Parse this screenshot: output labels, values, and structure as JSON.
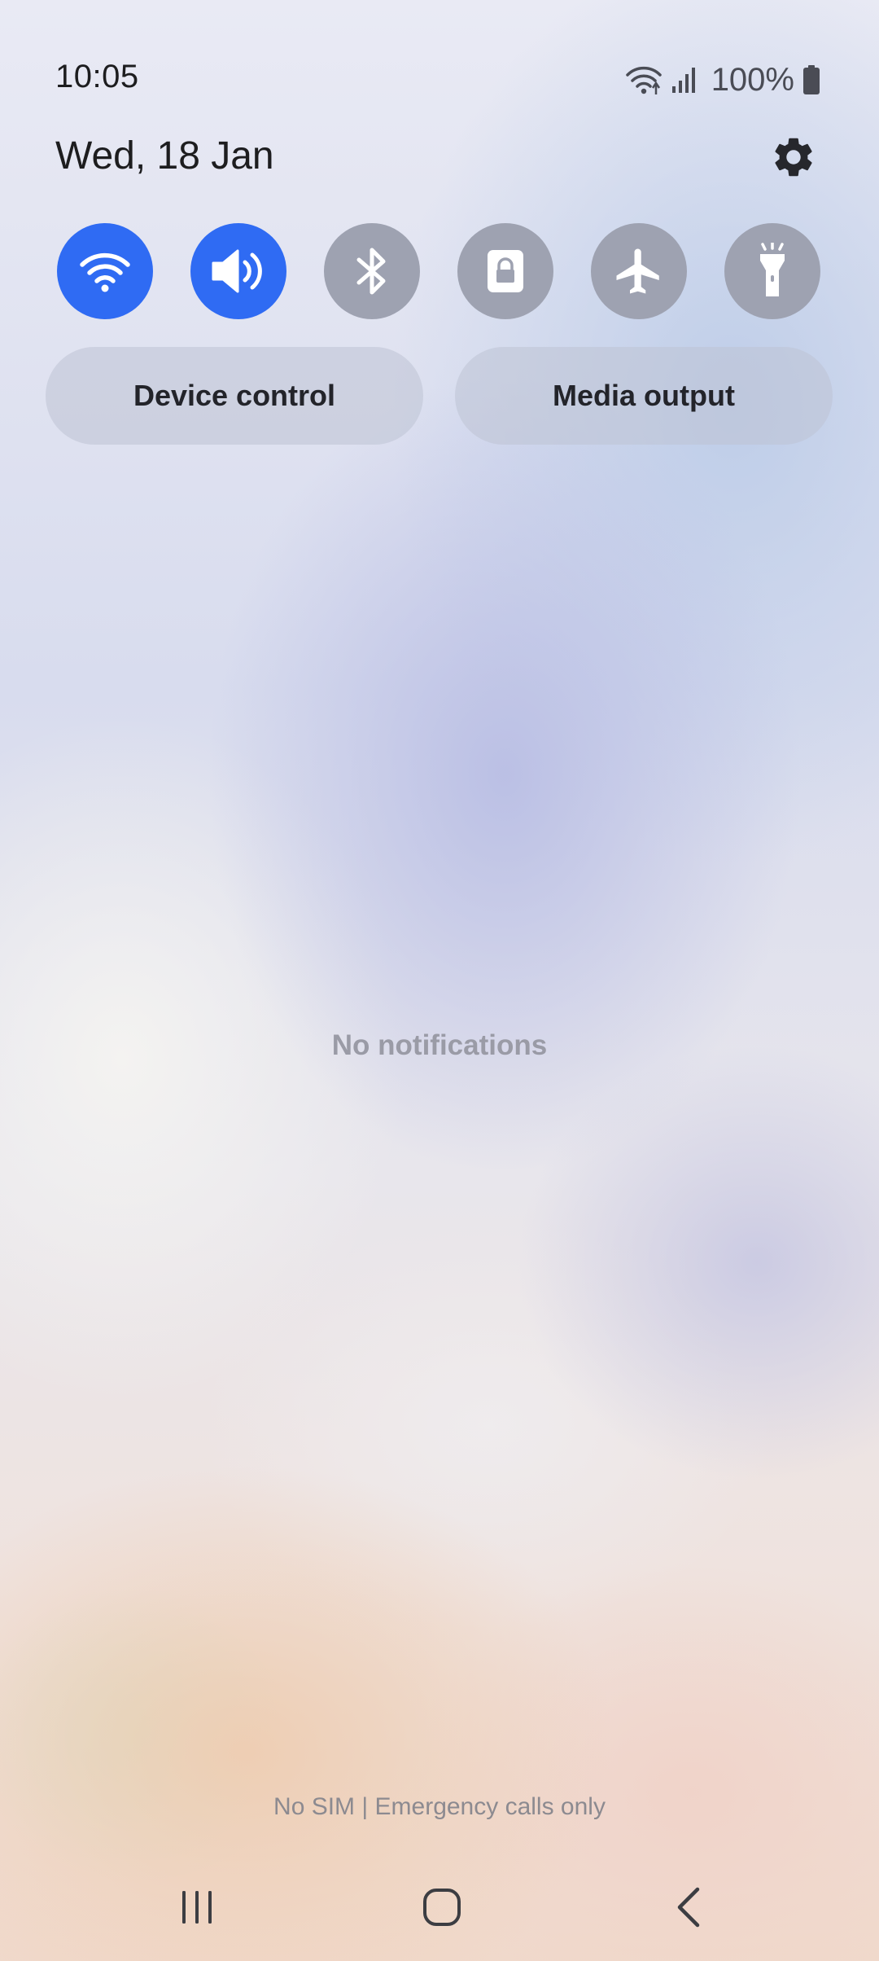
{
  "status_bar": {
    "time": "10:05",
    "battery": "100%",
    "icons": [
      "wifi-icon",
      "signal-icon",
      "battery-icon"
    ]
  },
  "panel": {
    "date": "Wed, 18 Jan",
    "settings_icon": "gear-icon"
  },
  "quick_toggles": [
    {
      "name": "wifi",
      "icon": "wifi-icon",
      "state": "on"
    },
    {
      "name": "sound",
      "icon": "speaker-icon",
      "state": "on"
    },
    {
      "name": "bluetooth",
      "icon": "bluetooth-icon",
      "state": "off"
    },
    {
      "name": "portrait-lock",
      "icon": "lock-icon",
      "state": "off"
    },
    {
      "name": "airplane",
      "icon": "airplane-icon",
      "state": "off"
    },
    {
      "name": "flashlight",
      "icon": "flashlight-icon",
      "state": "off"
    }
  ],
  "buttons": {
    "device_control": "Device control",
    "media_output": "Media output"
  },
  "notifications": {
    "empty_text": "No notifications"
  },
  "carrier": {
    "text": "No SIM | Emergency calls only"
  },
  "navigation": [
    "recents-icon",
    "home-icon",
    "back-icon"
  ],
  "colors": {
    "toggle_on": "#2f6bf3",
    "toggle_off": "#9ea2b1"
  }
}
